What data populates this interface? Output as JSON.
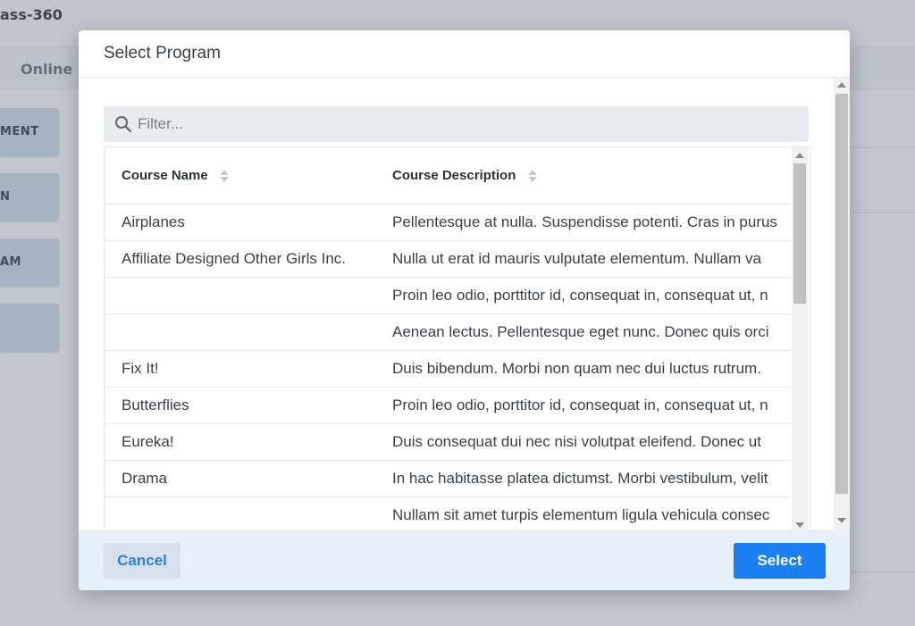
{
  "background": {
    "app_title": "ass-360",
    "tab_label": "Online S",
    "sidebar_buttons": [
      "MENT",
      "N",
      "AM",
      ""
    ]
  },
  "modal": {
    "title": "Select Program",
    "filter": {
      "placeholder": "Filter...",
      "value": ""
    },
    "columns": [
      "Course Name",
      "Course Description"
    ],
    "rows": [
      {
        "name": "Airplanes",
        "description": "Pellentesque at nulla. Suspendisse potenti. Cras in purus"
      },
      {
        "name": "Affiliate Designed Other Girls Inc.",
        "description": "Nulla ut erat id mauris vulputate elementum. Nullam va"
      },
      {
        "name": "",
        "description": "Proin leo odio, porttitor id, consequat in, consequat ut, n"
      },
      {
        "name": "",
        "description": "Aenean lectus. Pellentesque eget nunc. Donec quis orci"
      },
      {
        "name": "Fix It!",
        "description": "Duis bibendum. Morbi non quam nec dui luctus rutrum."
      },
      {
        "name": "Butterflies",
        "description": "Proin leo odio, porttitor id, consequat in, consequat ut, n"
      },
      {
        "name": "Eureka!",
        "description": "Duis consequat dui nec nisi volutpat eleifend. Donec ut"
      },
      {
        "name": "Drama",
        "description": "In hac habitasse platea dictumst. Morbi vestibulum, velit"
      },
      {
        "name": "",
        "description": "Nullam sit amet turpis elementum ligula vehicula consec"
      }
    ],
    "cancel_label": "Cancel",
    "select_label": "Select"
  },
  "colors": {
    "primary": "#1a7ff0",
    "cancel_text": "#2f7fd6",
    "footer_bg": "#e6f0fb"
  }
}
